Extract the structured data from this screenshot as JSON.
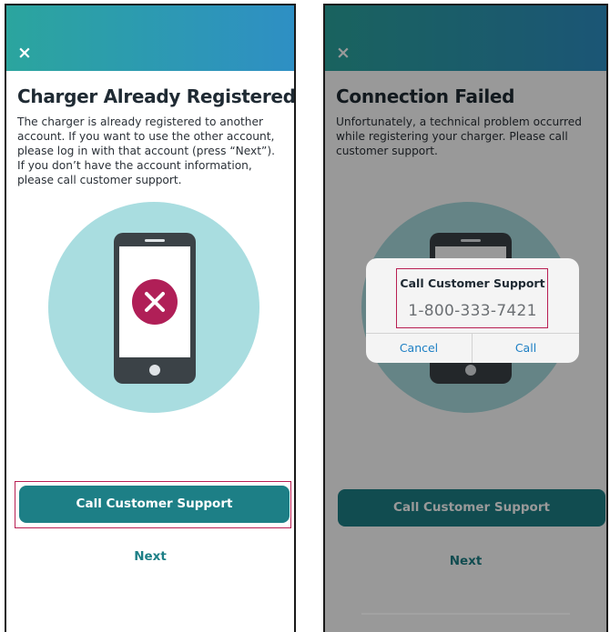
{
  "left_screen": {
    "topbar_gradient": [
      "#2ba59e",
      "#2e8fc4"
    ],
    "close_icon": "×",
    "title": "Charger Already Registered",
    "description": "The charger is already registered to another account. If you want to use the other account, please log in with that account (press “Next”). If you don’t have the account information, please call customer support.",
    "primary_button": "Call Customer Support",
    "secondary_link": "Next"
  },
  "right_screen": {
    "topbar_gradient": [
      "#2ba59e",
      "#2e8fc4"
    ],
    "close_icon": "×",
    "title": "Connection Failed",
    "description": "Unfortunately, a technical problem occurred while registering your charger. Please call customer support.",
    "primary_button": "Call Customer Support",
    "secondary_link": "Next",
    "dialog": {
      "title": "Call Customer Support",
      "phone_number": "1-800-333-7421",
      "cancel_label": "Cancel",
      "call_label": "Call"
    }
  },
  "colors": {
    "accent": "#1d7f86",
    "illustration_circle": "#a9dde0",
    "error_badge": "#b01f57",
    "highlight_border": "#b81e52",
    "ios_link": "#1c7fc4"
  }
}
